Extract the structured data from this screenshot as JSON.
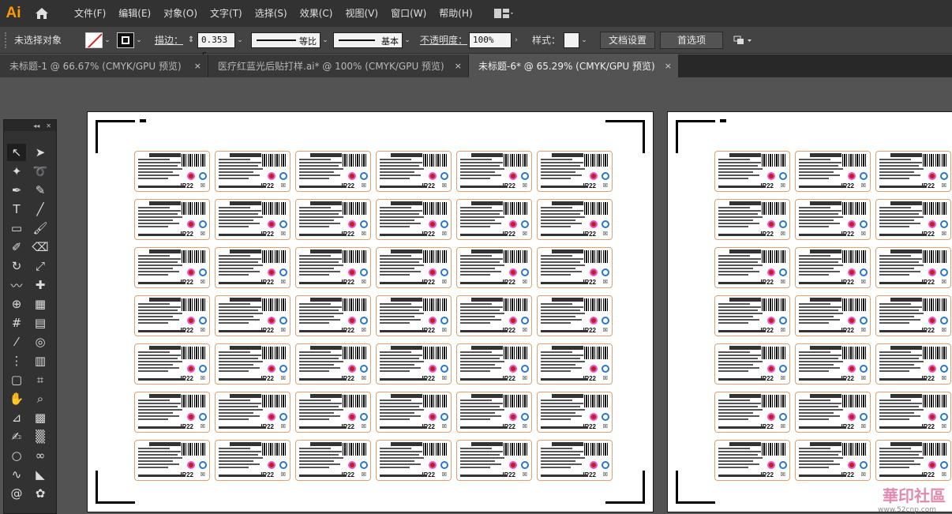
{
  "app": {
    "logo": "Ai"
  },
  "menu": {
    "items": [
      "文件(F)",
      "编辑(E)",
      "对象(O)",
      "文字(T)",
      "选择(S)",
      "效果(C)",
      "视图(V)",
      "窗口(W)",
      "帮助(H)"
    ]
  },
  "control": {
    "selection_status": "未选择对象",
    "stroke_label": "描边：",
    "stroke_weight": "0.353 r",
    "profile_label": "等比",
    "brush_label": "基本",
    "opacity_label": "不透明度：",
    "opacity_value": "100%",
    "style_label": "样式：",
    "doc_setup": "文档设置",
    "preferences": "首选项"
  },
  "tabs": [
    {
      "label": "未标题-1 @ 66.67% (CMYK/GPU 预览)",
      "active": false
    },
    {
      "label": "医疗红蓝光后贴打样.ai* @ 100% (CMYK/GPU 预览)",
      "active": false
    },
    {
      "label": "未标题-6* @ 65.29% (CMYK/GPU 预览)",
      "active": true
    }
  ],
  "tab_close_glyph": "×",
  "label_card": {
    "rating": "IP22",
    "disposal_glyph": "☒"
  },
  "colors": {
    "accent": "#ff9a00",
    "menubar": "#323232",
    "control": "#434343",
    "canvas": "#535353"
  },
  "watermark": {
    "text": "華印社區",
    "sub": "www.52cnp.com"
  }
}
